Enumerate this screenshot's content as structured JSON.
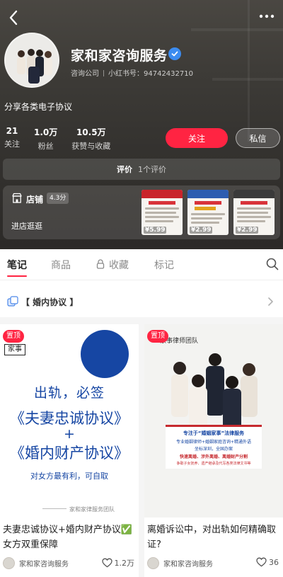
{
  "profile": {
    "name": "家和家咨询服务",
    "category": "咨询公司",
    "redbook_id": "小红书号：94742432710",
    "bio": "分享各类电子协议"
  },
  "stats": [
    {
      "value": "21",
      "label": "关注"
    },
    {
      "value": "1.0万",
      "label": "粉丝"
    },
    {
      "value": "10.5万",
      "label": "获赞与收藏"
    }
  ],
  "actions": {
    "follow": "关注",
    "message": "私信"
  },
  "rating": {
    "label": "评价",
    "value": "1个评价"
  },
  "shop": {
    "title": "店铺",
    "score": "4.3分",
    "visit": "进店逛逛",
    "prices": [
      "¥5.99",
      "¥2.99",
      "¥2.99"
    ]
  },
  "tabs": [
    "笔记",
    "商品",
    "收藏",
    "标记"
  ],
  "collection": {
    "label": "【 婚内协议 】"
  },
  "notes": [
    {
      "pin": "置顶",
      "tag": "家事",
      "cover_line1": "出轨，必签",
      "cover_line2": "《夫妻忠诚协议》",
      "cover_plus": "+",
      "cover_line3": "《婚内财产协议》",
      "cover_note": "对女方最有利，可自取",
      "cover_sign": "家和家律服务团队",
      "title": "夫妻忠诚协议+婚内财产协议✅女方双重保障",
      "author": "家和家咨询服务",
      "likes": "1.2万"
    },
    {
      "pin": "置顶",
      "cover_top": "家事律师团队",
      "banner": [
        "专注于“婚姻家事”法律服务",
        "专业婚姻律师+婚姻家庭咨询+精通外语",
        "坐标深圳，全国办案",
        "快速离婚、涉外离婚、离婚财产分割",
        "争取子女抚养、遗产继承及代写各类法律文书等"
      ],
      "title": "离婚诉讼中，对出轨如何精确取证?",
      "author": "家和家咨询服务",
      "likes": "36"
    }
  ],
  "colors": {
    "brand_red": "#ff2442",
    "verified_blue": "#3c8cf0",
    "cover_blue": "#1646a3"
  }
}
